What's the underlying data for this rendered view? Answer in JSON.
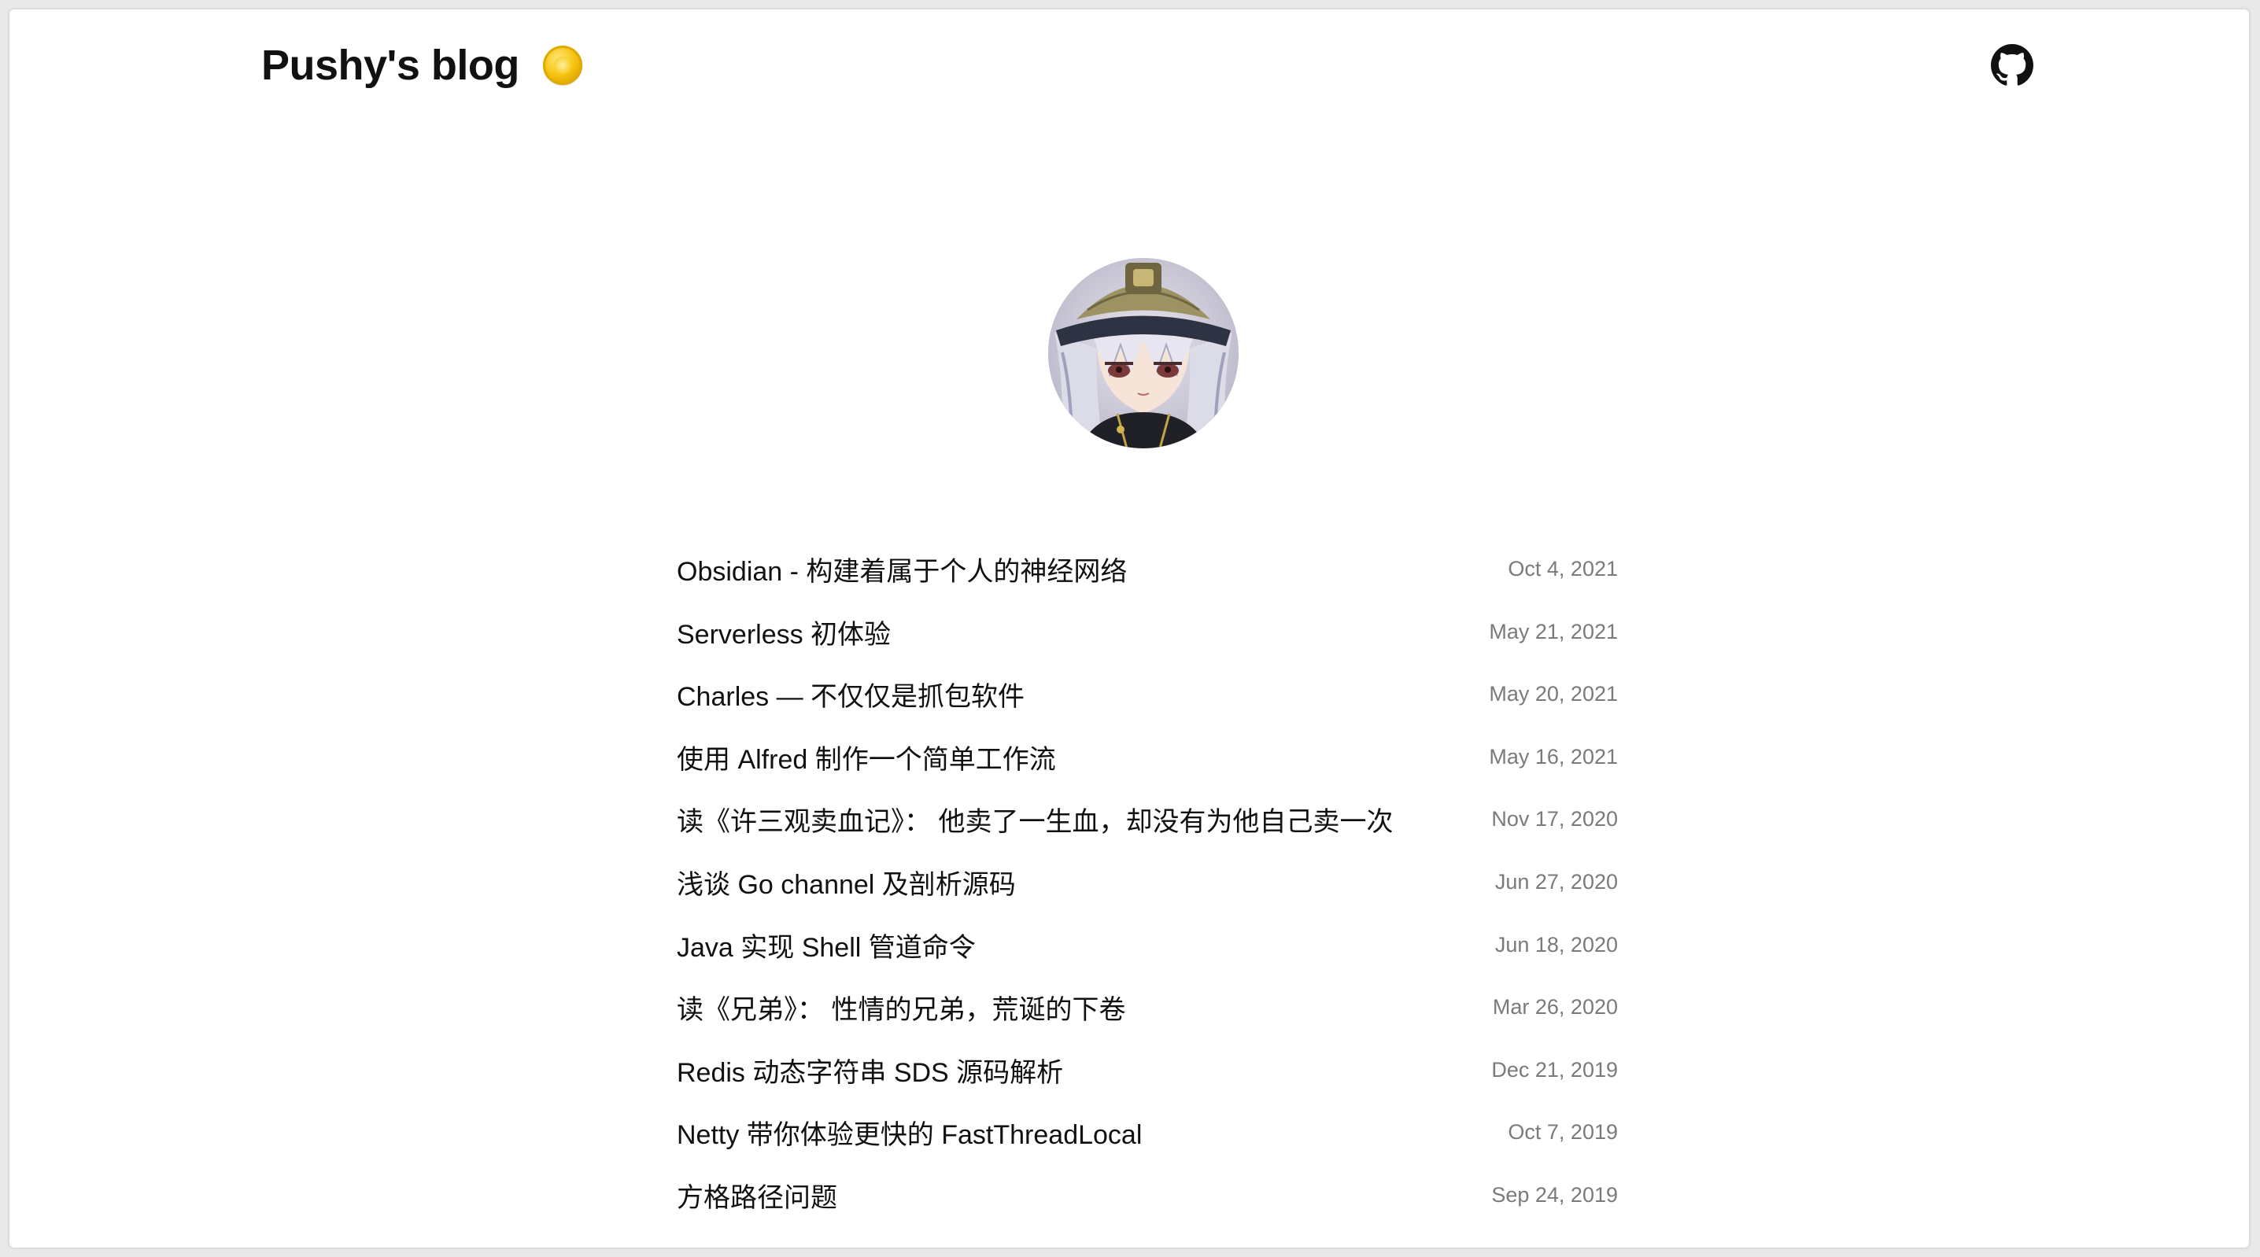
{
  "header": {
    "site_title": "Pushy's blog",
    "logo_icon": "coin-icon",
    "github_icon": "github-icon"
  },
  "profile": {
    "avatar": "anime-character-avatar"
  },
  "posts": [
    {
      "title": "Obsidian - 构建着属于个人的神经网络",
      "date": "Oct 4, 2021"
    },
    {
      "title": "Serverless 初体验",
      "date": "May 21, 2021"
    },
    {
      "title": "Charles — 不仅仅是抓包软件",
      "date": "May 20, 2021"
    },
    {
      "title": "使用 Alfred 制作一个简单工作流",
      "date": "May 16, 2021"
    },
    {
      "title": "读《许三观卖血记》： 他卖了一生血，却没有为他自己卖一次",
      "date": "Nov 17, 2020"
    },
    {
      "title": "浅谈 Go channel 及剖析源码",
      "date": "Jun 27, 2020"
    },
    {
      "title": "Java 实现 Shell 管道命令",
      "date": "Jun 18, 2020"
    },
    {
      "title": "读《兄弟》： 性情的兄弟，荒诞的下卷",
      "date": "Mar 26, 2020"
    },
    {
      "title": "Redis 动态字符串 SDS 源码解析",
      "date": "Dec 21, 2019"
    },
    {
      "title": "Netty 带你体验更快的 FastThreadLocal",
      "date": "Oct 7, 2019"
    },
    {
      "title": "方格路径问题",
      "date": "Sep 24, 2019"
    }
  ],
  "colors": {
    "title": "#111111",
    "date": "#7a7a7a",
    "background": "#ffffff"
  }
}
